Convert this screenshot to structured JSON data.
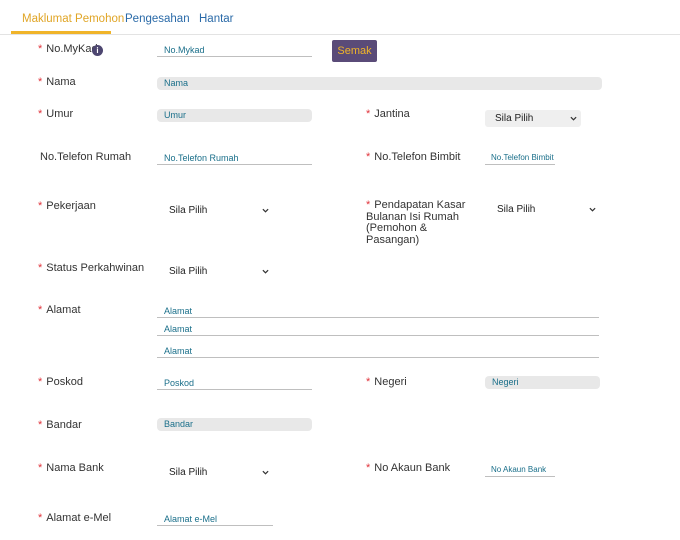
{
  "tabs": [
    {
      "label": "Maklumat Pemohon"
    },
    {
      "label": "Pengesahan"
    },
    {
      "label": "Hantar"
    }
  ],
  "form": {
    "mykad": {
      "label": "No.MyKad",
      "placeholder": "No.Mykad",
      "info": "i",
      "button": "Semak"
    },
    "nama": {
      "label": "Nama",
      "placeholder": "Nama"
    },
    "umur": {
      "label": "Umur",
      "placeholder": "Umur"
    },
    "jantina": {
      "label": "Jantina",
      "selected": "Sila Pilih"
    },
    "tel_rumah": {
      "label": "No.Telefon Rumah",
      "placeholder": "No.Telefon Rumah"
    },
    "tel_bimbit": {
      "label": "No.Telefon Bimbit",
      "placeholder": "No.Telefon Bimbit"
    },
    "pekerjaan": {
      "label": "Pekerjaan",
      "selected": "Sila Pilih"
    },
    "pendapatan": {
      "label_line1": "Pendapatan Kasar",
      "label_line2": "Bulanan Isi Rumah",
      "label_line3": "(Pemohon &",
      "label_line4": "Pasangan)",
      "selected": "Sila Pilih"
    },
    "status": {
      "label": "Status Perkahwinan",
      "selected": "Sila Pilih"
    },
    "alamat": {
      "label": "Alamat",
      "placeholder1": "Alamat",
      "placeholder2": "Alamat",
      "placeholder3": "Alamat"
    },
    "poskod": {
      "label": "Poskod",
      "placeholder": "Poskod"
    },
    "negeri": {
      "label": "Negeri",
      "placeholder": "Negeri"
    },
    "bandar": {
      "label": "Bandar",
      "placeholder": "Bandar"
    },
    "bank": {
      "label": "Nama Bank",
      "selected": "Sila Pilih"
    },
    "akaun": {
      "label": "No Akaun Bank",
      "placeholder": "No Akaun Bank"
    },
    "email": {
      "label": "Alamat e-Mel",
      "placeholder": "Alamat e-Mel"
    }
  },
  "required_mark": "*",
  "colors": {
    "accent": "#f0b429",
    "button_bg": "#5a4b78",
    "link": "#2a6aa8",
    "required": "#e0323a"
  }
}
